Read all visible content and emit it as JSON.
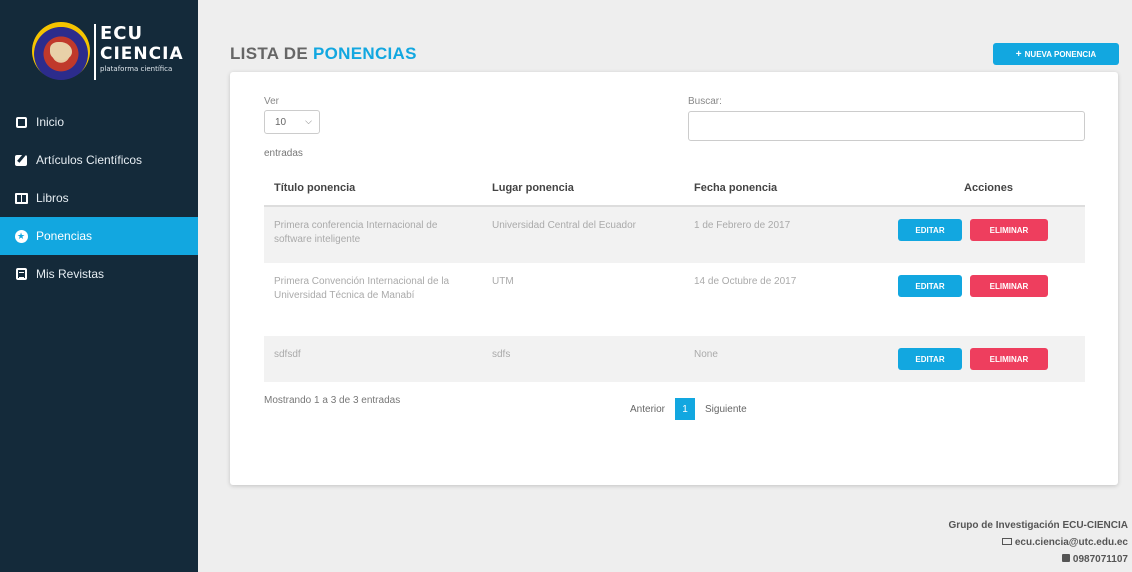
{
  "brand": {
    "line1": "ECU",
    "line2": "CIENCIA",
    "tagline": "plataforma científica"
  },
  "sidebar": {
    "items": [
      {
        "label": "Inicio",
        "icon": "square-icon",
        "active": false
      },
      {
        "label": "Artículos Científicos",
        "icon": "edit-icon",
        "active": false
      },
      {
        "label": "Libros",
        "icon": "book-icon",
        "active": false
      },
      {
        "label": "Ponencias",
        "icon": "star-circle-icon",
        "active": true
      },
      {
        "label": "Mis Revistas",
        "icon": "document-icon",
        "active": false
      }
    ]
  },
  "header": {
    "title_plain": "LISTA DE ",
    "title_accent": "PONENCIAS",
    "new_button": "NUEVA PONENCIA",
    "new_button_icon": "+"
  },
  "table_controls": {
    "length_label": "Ver",
    "length_value": "10",
    "entries_label": "entradas",
    "search_label": "Buscar:",
    "search_value": ""
  },
  "table": {
    "columns": [
      "Título ponencia",
      "Lugar ponencia",
      "Fecha ponencia",
      "Acciones"
    ],
    "rows": [
      {
        "titulo": "Primera conferencia Internacional de software inteligente",
        "lugar": "Universidad Central del Ecuador",
        "fecha": "1 de Febrero de 2017",
        "edit": "EDITAR",
        "delete": "ELIMINAR"
      },
      {
        "titulo": "Primera Convención Internacional de la Universidad Técnica de Manabí",
        "lugar": "UTM",
        "fecha": "14 de Octubre de 2017",
        "edit": "EDITAR",
        "delete": "ELIMINAR"
      },
      {
        "titulo": "sdfsdf",
        "lugar": "sdfs",
        "fecha": "None",
        "edit": "EDITAR",
        "delete": "ELIMINAR"
      }
    ]
  },
  "pagination": {
    "info": "Mostrando 1 a 3 de 3 entradas",
    "prev": "Anterior",
    "current": "1",
    "next": "Siguiente"
  },
  "footer": {
    "group": "Grupo de Investigación ECU-CIENCIA",
    "email": "ecu.ciencia@utc.edu.ec",
    "phone": "0987071107"
  },
  "colors": {
    "sidebar_bg": "#142a3a",
    "accent": "#12a7e0",
    "danger": "#ee3e5e"
  }
}
